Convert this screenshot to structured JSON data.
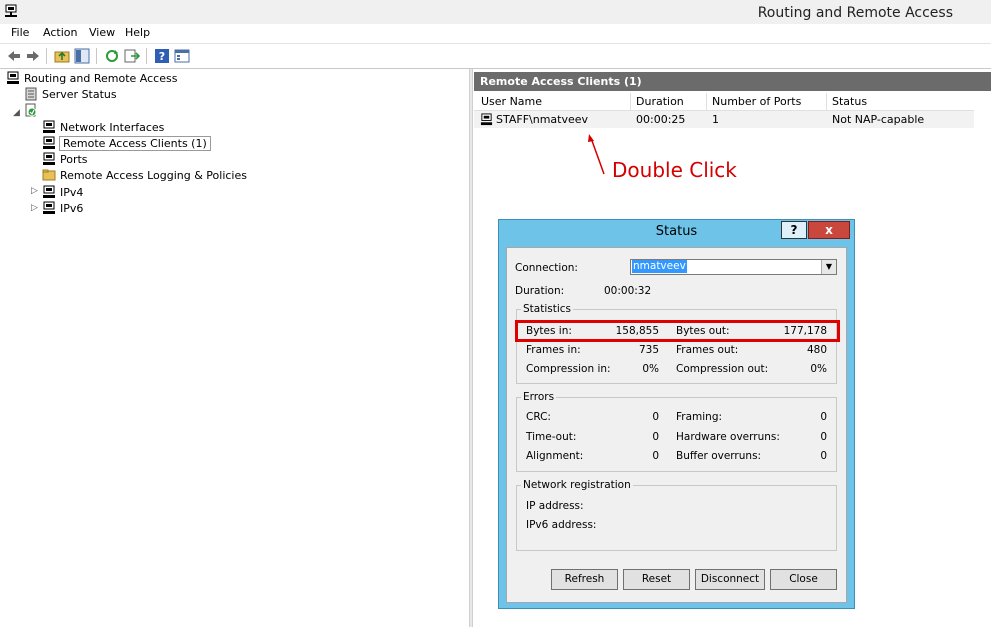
{
  "window": {
    "title": "Routing and Remote Access"
  },
  "menu": [
    "File",
    "Action",
    "View",
    "Help"
  ],
  "toolbar": {
    "icons": [
      "back-arrow-icon",
      "forward-arrow-icon",
      "up-folder-icon",
      "show-hide-tree-icon",
      "refresh-icon",
      "export-list-icon",
      "help-icon",
      "properties-icon"
    ]
  },
  "tree": {
    "root": "Routing and Remote Access",
    "server_status": "Server Status",
    "network_interfaces": "Network Interfaces",
    "remote_access_clients": "Remote Access Clients (1)",
    "ports": "Ports",
    "logging": "Remote Access Logging & Policies",
    "ipv4": "IPv4",
    "ipv6": "IPv6"
  },
  "list": {
    "header": "Remote Access Clients (1)",
    "columns": [
      "User Name",
      "Duration",
      "Number of Ports",
      "Status"
    ],
    "rows": [
      {
        "user": "STAFF\\nmatveev",
        "duration": "00:00:25",
        "ports": "1",
        "status": "Not NAP-capable"
      }
    ]
  },
  "annotation": {
    "text": "Double Click",
    "color": "#d40000"
  },
  "dialog": {
    "title": "Status",
    "help_label": "?",
    "close_label": "x",
    "connection_label": "Connection:",
    "connection_value": "nmatveev",
    "duration_label": "Duration:",
    "duration_value": "00:00:32",
    "statistics": {
      "title": "Statistics",
      "bytes_in_label": "Bytes in:",
      "bytes_in": "158,855",
      "bytes_out_label": "Bytes out:",
      "bytes_out": "177,178",
      "frames_in_label": "Frames in:",
      "frames_in": "735",
      "frames_out_label": "Frames out:",
      "frames_out": "480",
      "comp_in_label": "Compression in:",
      "comp_in": "0%",
      "comp_out_label": "Compression out:",
      "comp_out": "0%"
    },
    "errors": {
      "title": "Errors",
      "crc_label": "CRC:",
      "crc": "0",
      "framing_label": "Framing:",
      "framing": "0",
      "timeout_label": "Time-out:",
      "timeout": "0",
      "hw_label": "Hardware overruns:",
      "hw": "0",
      "align_label": "Alignment:",
      "align": "0",
      "buffer_label": "Buffer overruns:",
      "buffer": "0"
    },
    "network": {
      "title": "Network registration",
      "ip_label": "IP address:",
      "ipv6_label": "IPv6 address:"
    },
    "buttons": {
      "refresh": "Refresh",
      "reset": "Reset",
      "disconnect": "Disconnect",
      "close": "Close"
    }
  }
}
